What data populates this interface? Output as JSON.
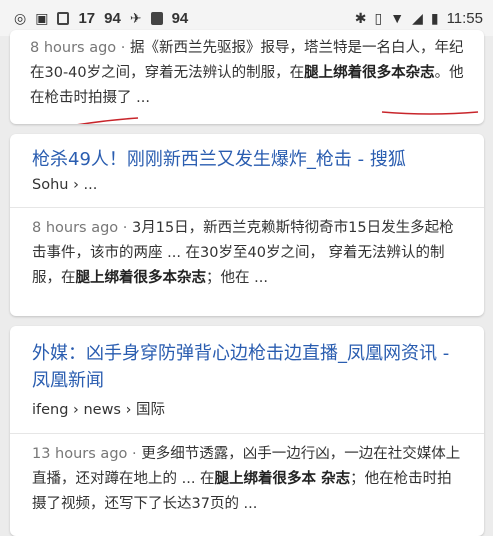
{
  "status_bar": {
    "left_values": [
      "17",
      "94",
      "94"
    ],
    "time": "11:55"
  },
  "results": [
    {
      "snippet": {
        "time": "8 hours ago",
        "sep": " · ",
        "text_before": "据《新西兰先驱报》报导，塔兰特是一名白人，年纪在30-40岁之间，穿着无法辨认的制服，在",
        "bold": "腿上绑着很多本杂志",
        "text_after": "。他在枪击时拍摄了 ..."
      }
    },
    {
      "title": "枪杀49人！刚刚新西兰又发生爆炸_枪击 - 搜狐",
      "source": "Sohu › ...",
      "snippet": {
        "time": "8 hours ago",
        "sep": " · ",
        "text_before": "3月15日，新西兰克赖斯特彻奇市15日发生多起枪击事件，该市的两座 ... 在30岁至40岁之间， 穿着无法辨认的制服，在",
        "bold": "腿上绑着很多本杂志",
        "text_after": "；他在 ..."
      }
    },
    {
      "title": "外媒：凶手身穿防弹背心边枪击边直播_凤凰网资讯 - 凤凰新闻",
      "source": "ifeng › news › 国际",
      "snippet": {
        "time": "13 hours ago",
        "sep": " · ",
        "text_before": "更多细节透露，凶手一边行凶，一边在社交媒体上直播，还对蹲在地上的 ... 在",
        "bold": "腿上绑着很多本 杂志",
        "text_after": "；他在枪击时拍摄了视频，还写下了长达37页的 ..."
      }
    }
  ],
  "colors": {
    "link": "#2a5db0",
    "annotation": "#c8252b"
  }
}
